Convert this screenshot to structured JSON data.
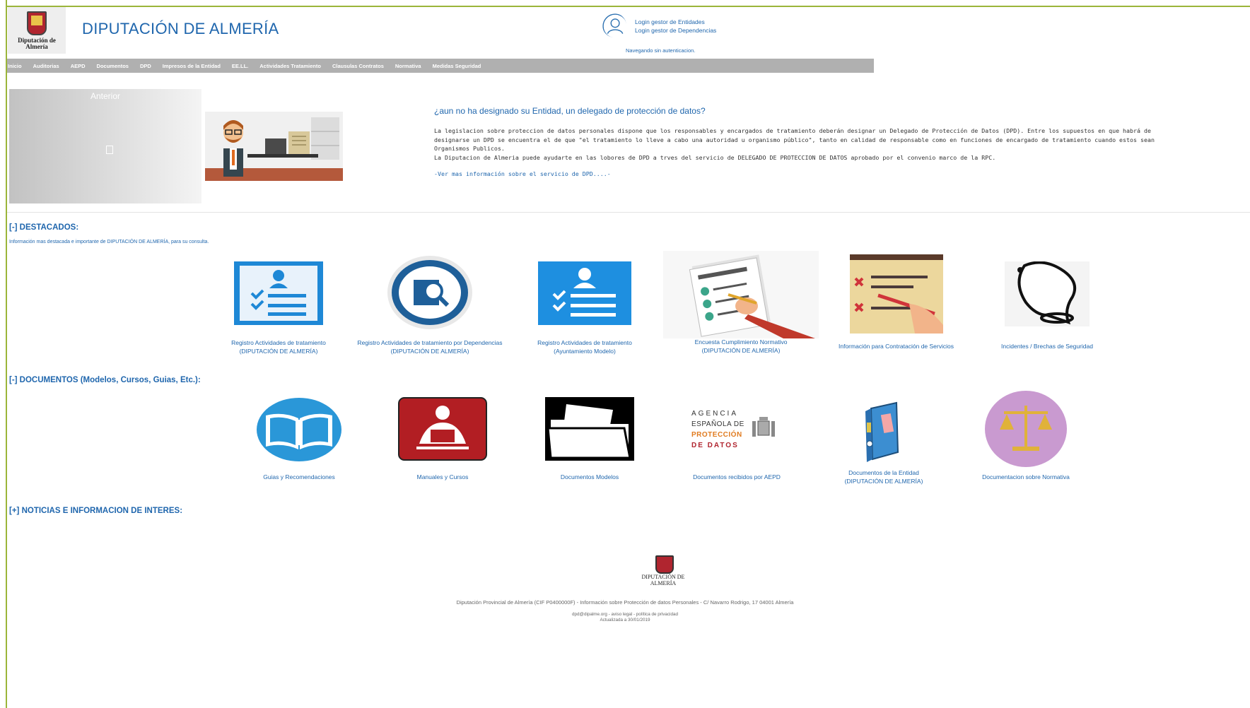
{
  "header": {
    "logo_text": "Diputación de Almería",
    "title": "DIPUTACIÓN DE ALMERÍA",
    "login_entidades": "Login gestor de Entidades",
    "login_dependencias": "Login gestor de Dependencias",
    "auth_status": "Navegando sin autenticacion."
  },
  "menu": [
    "Inicio",
    "Auditorias",
    "AEPD",
    "Documentos",
    "DPD",
    "Impresos de la Entidad",
    "EE.LL.",
    "Actividades Tratamiento",
    "Clausulas Contratos",
    "Normativa",
    "Medidas Seguridad"
  ],
  "carousel": {
    "prev_label": "Anterior"
  },
  "intro": {
    "question": "¿aun no ha designado su Entidad, un delegado de protección de datos?",
    "line1": "La legislacion sobre proteccion de datos personales dispone que los responsables y encargados de tratamiento deberán designar un Delegado de Protección de Datos (DPD). Entre los supuestos en que habrá de",
    "line2": "designarse un DPD se encuentra el de que \"el tratamiento lo lleve a cabo una autoridad u organismo público\", tanto en calidad de responsable como en funciones de encargado de tratamiento cuando estos sean",
    "line3": "Organismos Publicos.",
    "line4": "La Diputacion de Almeria puede ayudarte en las lobores de DPD a trves del servicio de DELEGADO DE PROTECCION DE DATOS aprobado por el convenio marco de la  RPC.",
    "more_link": "-Ver mas información sobre el servicio de DPD....-"
  },
  "destacados": {
    "heading": "[-] DESTACADOS:",
    "subtitle": "Información mas destacada e importante de DIPUTACIÓN DE ALMERÍA, para su consulta.",
    "items": [
      {
        "line1": "Registro Actividades de tratamiento",
        "line2": "(DIPUTACIÓN DE ALMERÍA)"
      },
      {
        "line1": "Registro Actividades de tratamiento por Dependencias",
        "line2": "(DIPUTACIÓN DE ALMERÍA)"
      },
      {
        "line1": "Registro Actividades de tratamiento",
        "line2": "(Ayuntamiento Modelo)"
      },
      {
        "line1": "Encuesta Cumplimiento Normativo",
        "line2": "(DIPUTACIÓN DE ALMERÍA)"
      },
      {
        "line1": "Información para Contratación de Servicios",
        "line2": ""
      },
      {
        "line1": "Incidentes / Brechas de Seguridad",
        "line2": ""
      }
    ]
  },
  "documentos": {
    "heading": "[-] DOCUMENTOS (Modelos, Cursos, Guias, Etc.):",
    "items": [
      {
        "line1": "Guias y Recomendaciones",
        "line2": ""
      },
      {
        "line1": "Manuales y Cursos",
        "line2": ""
      },
      {
        "line1": "Documentos Modelos",
        "line2": ""
      },
      {
        "line1": "Documentos recibidos por AEPD",
        "line2": ""
      },
      {
        "line1": "Documentos de la Entidad",
        "line2": "(DIPUTACIÓN DE ALMERÍA)"
      },
      {
        "line1": "Documentacion sobre Normativa",
        "line2": ""
      }
    ],
    "aepd_logo": {
      "l1": "AGENCIA",
      "l2": "ESPAÑOLA DE",
      "l3": "PROTECCIÓN",
      "l4": "DE  DATOS"
    }
  },
  "noticias": {
    "heading": "[+] NOTICIAS E INFORMACION DE INTERES:"
  },
  "footer": {
    "logo_text": "DIPUTACIÓN DE ALMERÍA",
    "line": "Diputación Provincial de Almería (CIF P0400000F) - Información sobre Protección de datos Personales - C/ Navarro Rodrigo, 17 04001 Almería",
    "links": "dpd@dipalme.org - aviso legal - política de privacidad",
    "updated": "Actualizada a 30/01/2019"
  },
  "colors": {
    "accent": "#1f66ad",
    "menu_bg": "#b0b0b0",
    "frame": "#9bb53a"
  }
}
